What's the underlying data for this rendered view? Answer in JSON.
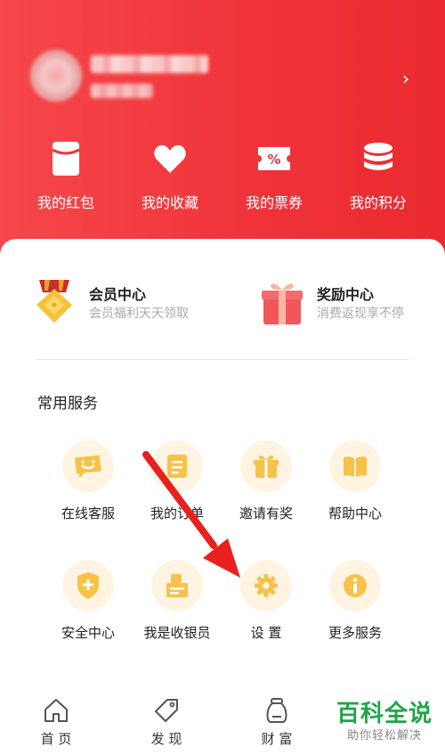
{
  "header": {
    "chevron": "›"
  },
  "quick_actions": [
    {
      "label": "我的红包",
      "icon": "red-packet-icon"
    },
    {
      "label": "我的收藏",
      "icon": "heart-icon"
    },
    {
      "label": "我的票券",
      "icon": "coupon-icon"
    },
    {
      "label": "我的积分",
      "icon": "coins-icon"
    }
  ],
  "promos": [
    {
      "title": "会员中心",
      "subtitle": "会员福利天天领取",
      "icon": "medal-icon"
    },
    {
      "title": "奖励中心",
      "subtitle": "消费返现享不停",
      "icon": "gift-box-icon"
    }
  ],
  "section": {
    "title": "常用服务"
  },
  "services": [
    {
      "label": "在线客服",
      "icon": "chat-bubble-icon"
    },
    {
      "label": "我的订单",
      "icon": "order-list-icon"
    },
    {
      "label": "邀请有奖",
      "icon": "gift-icon"
    },
    {
      "label": "帮助中心",
      "icon": "book-icon"
    },
    {
      "label": "安全中心",
      "icon": "shield-icon"
    },
    {
      "label": "我是收银员",
      "icon": "cashier-icon"
    },
    {
      "label": "设 置",
      "icon": "gear-icon"
    },
    {
      "label": "更多服务",
      "icon": "info-icon"
    }
  ],
  "bottom_nav": [
    {
      "label": "首 页",
      "icon": "home-icon"
    },
    {
      "label": "发 现",
      "icon": "tag-icon"
    },
    {
      "label": "财 富",
      "icon": "money-bag-icon"
    }
  ],
  "watermark": {
    "title": "百科全说",
    "subtitle": "助你轻松解决"
  },
  "colors": {
    "header_red": "#f0343a",
    "service_circle": "#fff4e2",
    "service_icon": "#f6c24a",
    "annotation_arrow": "#e8211e",
    "watermark_green": "#1fa64a"
  }
}
